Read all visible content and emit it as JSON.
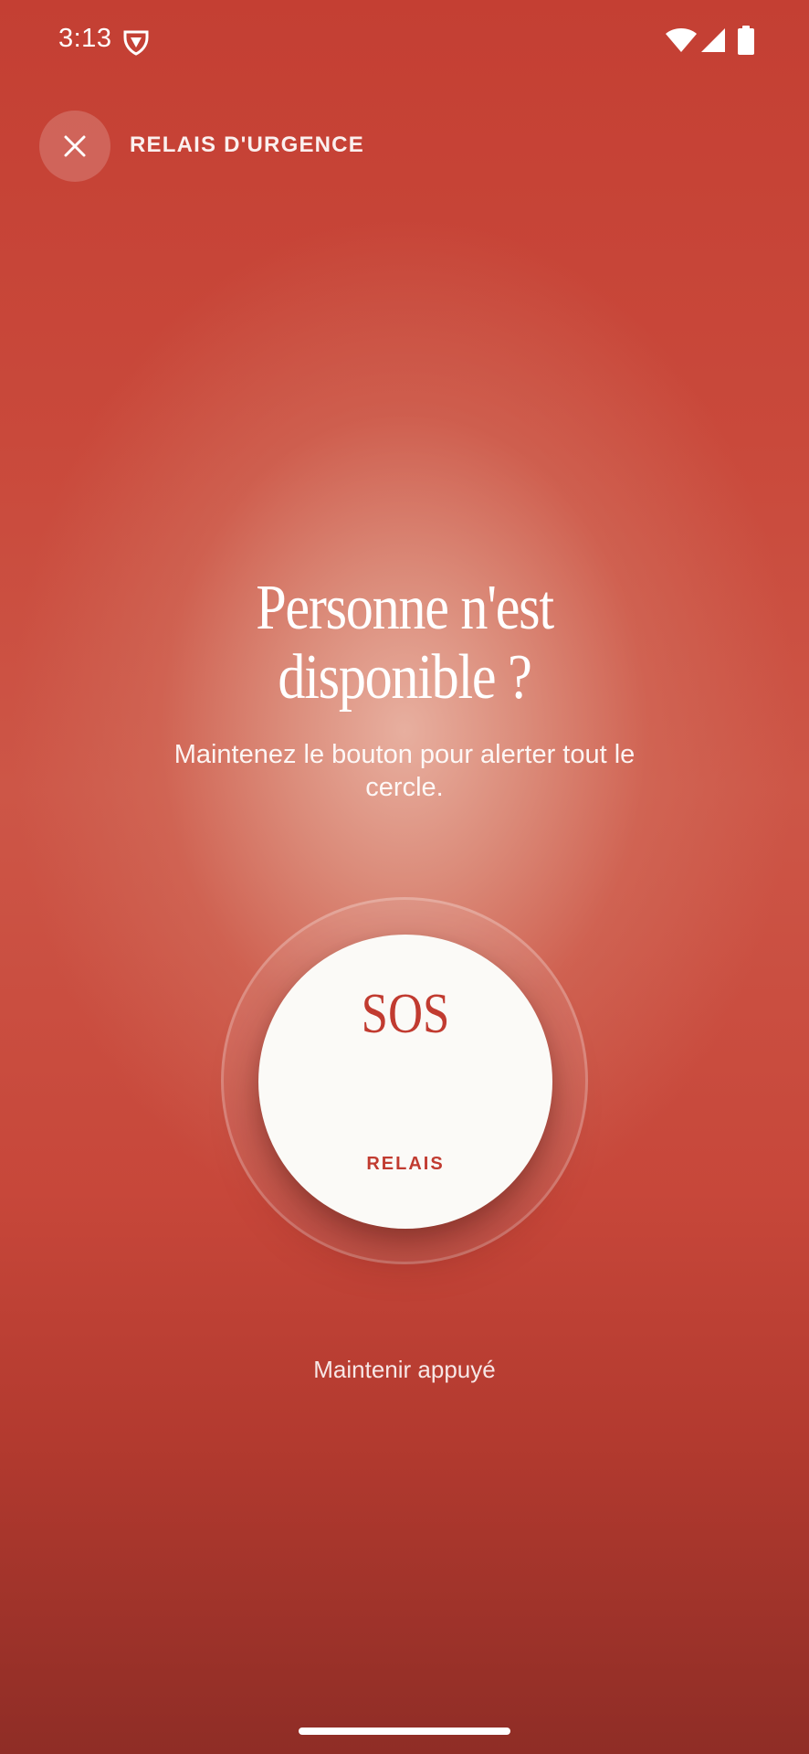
{
  "status_bar": {
    "time": "3:13",
    "icons": [
      "shield-badge-icon",
      "wifi-icon",
      "cell-signal-icon",
      "battery-icon"
    ]
  },
  "header": {
    "close_icon": "close-icon",
    "title": "RELAIS D'URGENCE"
  },
  "main": {
    "headline_line1": "Personne n'est",
    "headline_line2": "disponible ?",
    "subtitle": "Maintenez le bouton pour alerter tout le cercle.",
    "sos_button": {
      "label": "SOS",
      "sublabel": "RELAIS"
    },
    "hint": "Maintenir appuyé"
  },
  "colors": {
    "accent": "#c13b30",
    "background_top": "#c43f33",
    "background_bottom": "#8f2d26",
    "button_fill": "#fbfaf7"
  }
}
